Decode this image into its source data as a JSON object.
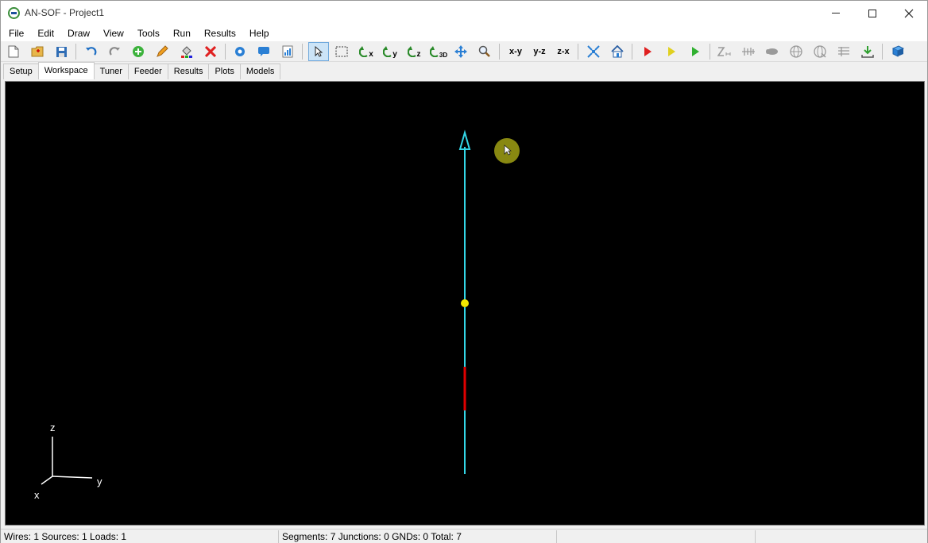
{
  "window": {
    "title": "AN-SOF - Project1"
  },
  "menu": [
    "File",
    "Edit",
    "Draw",
    "View",
    "Tools",
    "Run",
    "Results",
    "Help"
  ],
  "toolbar": {
    "view_xy": "x-y",
    "view_yz": "y-z",
    "view_zx": "z-x",
    "rotate_x": "x",
    "rotate_y": "y",
    "rotate_z": "z",
    "rotate_3d": "3D"
  },
  "tabs": [
    "Setup",
    "Workspace",
    "Tuner",
    "Feeder",
    "Results",
    "Plots",
    "Models"
  ],
  "active_tab": "Workspace",
  "workspace": {
    "axes": {
      "z": "z",
      "y": "y",
      "x": "x"
    },
    "colors": {
      "background": "#000000",
      "wire": "#33d6e6",
      "source": "#f2e600",
      "load": "#e00000",
      "axes": "#ffffff"
    }
  },
  "status": {
    "left": "Wires: 1  Sources: 1  Loads: 1",
    "middle": "Segments: 7  Junctions: 0  GNDs: 0  Total: 7"
  }
}
